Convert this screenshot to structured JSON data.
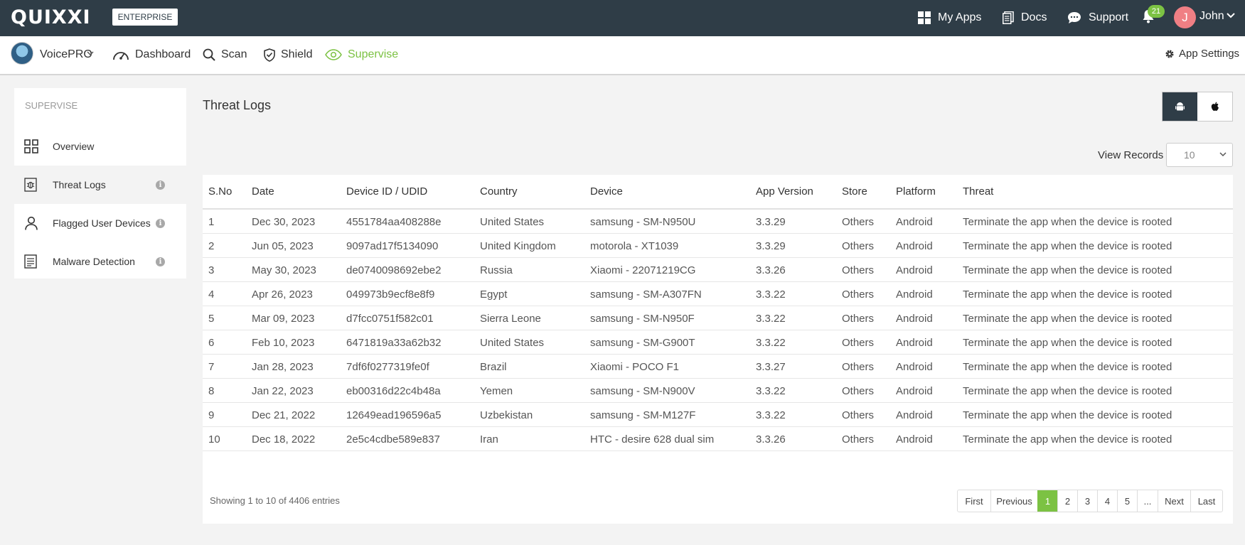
{
  "topbar": {
    "logo": "QUIXXI",
    "edition": "ENTERPRISE",
    "my_apps": "My Apps",
    "docs": "Docs",
    "support": "Support",
    "notification_count": "21",
    "user_initial": "J",
    "user_name": "John"
  },
  "subbar": {
    "app_name": "VoicePRO",
    "nav": {
      "dashboard": "Dashboard",
      "scan": "Scan",
      "shield": "Shield",
      "supervise": "Supervise"
    },
    "app_settings": "App Settings"
  },
  "sidebar": {
    "title": "SUPERVISE",
    "items": [
      {
        "label": "Overview"
      },
      {
        "label": "Threat Logs"
      },
      {
        "label": "Flagged User Devices"
      },
      {
        "label": "Malware Detection"
      }
    ]
  },
  "main": {
    "title": "Threat Logs",
    "view_records_label": "View Records",
    "view_records_value": "10",
    "columns": [
      "S.No",
      "Date",
      "Device ID / UDID",
      "Country",
      "Device",
      "App Version",
      "Store",
      "Platform",
      "Threat"
    ],
    "rows": [
      [
        "1",
        "Dec 30, 2023",
        "4551784aa408288e",
        "United States",
        "samsung - SM-N950U",
        "3.3.29",
        "Others",
        "Android",
        "Terminate the app when the device is rooted"
      ],
      [
        "2",
        "Jun 05, 2023",
        "9097ad17f5134090",
        "United Kingdom",
        "motorola - XT1039",
        "3.3.29",
        "Others",
        "Android",
        "Terminate the app when the device is rooted"
      ],
      [
        "3",
        "May 30, 2023",
        "de0740098692ebe2",
        "Russia",
        "Xiaomi - 22071219CG",
        "3.3.26",
        "Others",
        "Android",
        "Terminate the app when the device is rooted"
      ],
      [
        "4",
        "Apr 26, 2023",
        "049973b9ecf8e8f9",
        "Egypt",
        "samsung - SM-A307FN",
        "3.3.22",
        "Others",
        "Android",
        "Terminate the app when the device is rooted"
      ],
      [
        "5",
        "Mar 09, 2023",
        "d7fcc0751f582c01",
        "Sierra Leone",
        "samsung - SM-N950F",
        "3.3.22",
        "Others",
        "Android",
        "Terminate the app when the device is rooted"
      ],
      [
        "6",
        "Feb 10, 2023",
        "6471819a33a62b32",
        "United States",
        "samsung - SM-G900T",
        "3.3.22",
        "Others",
        "Android",
        "Terminate the app when the device is rooted"
      ],
      [
        "7",
        "Jan 28, 2023",
        "7df6f0277319fe0f",
        "Brazil",
        "Xiaomi - POCO F1",
        "3.3.27",
        "Others",
        "Android",
        "Terminate the app when the device is rooted"
      ],
      [
        "8",
        "Jan 22, 2023",
        "eb00316d22c4b48a",
        "Yemen",
        "samsung - SM-N900V",
        "3.3.22",
        "Others",
        "Android",
        "Terminate the app when the device is rooted"
      ],
      [
        "9",
        "Dec 21, 2022",
        "12649ead196596a5",
        "Uzbekistan",
        "samsung - SM-M127F",
        "3.3.22",
        "Others",
        "Android",
        "Terminate the app when the device is rooted"
      ],
      [
        "10",
        "Dec 18, 2022",
        "2e5c4cdbe589e837",
        "Iran",
        "HTC - desire 628 dual sim",
        "3.3.26",
        "Others",
        "Android",
        "Terminate the app when the device is rooted"
      ]
    ],
    "showing": "Showing 1 to 10 of 4406 entries",
    "pagination": [
      "First",
      "Previous",
      "1",
      "2",
      "3",
      "4",
      "5",
      "...",
      "Next",
      "Last"
    ],
    "active_page": "1"
  },
  "colors": {
    "topbar": "#2f3d47",
    "accent": "#7cc243",
    "avatar": "#f07f84"
  }
}
